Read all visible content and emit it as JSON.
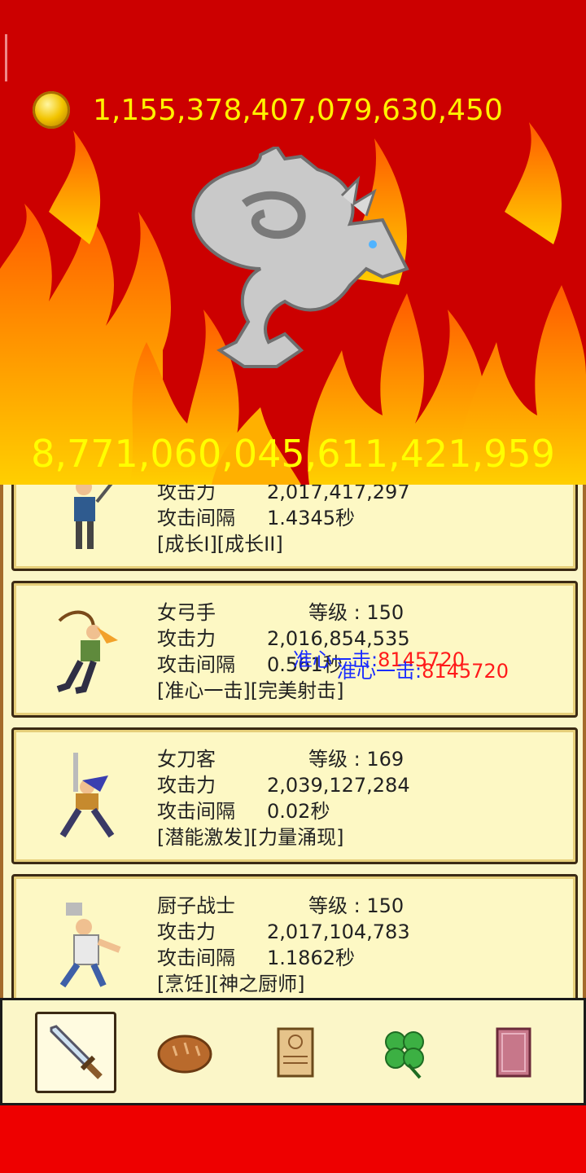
{
  "hud": {
    "gold_amount": "1,155,378,407,079,630,450",
    "boss_hp": "8,771,060,045,611,421,959"
  },
  "labels": {
    "attack": "攻击力",
    "interval": "攻击间隔",
    "level_prefix": "等级 : "
  },
  "heroes": [
    {
      "name": "",
      "level": "",
      "attack": "2,017,417,297",
      "interval": "1.4345秒",
      "skills": "[成长I][成长II]"
    },
    {
      "name": "女弓手",
      "level": "等级 : 150",
      "attack": "2,016,854,535",
      "interval": "0.561秒",
      "skills": "[准心一击][完美射击]"
    },
    {
      "name": "女刀客",
      "level": "等级 : 169",
      "attack": "2,039,127,284",
      "interval": "0.02秒",
      "skills": "[潜能激发][力量涌现]"
    },
    {
      "name": "厨子战士",
      "level": "等级 : 150",
      "attack": "2,017,104,783",
      "interval": "1.1862秒",
      "skills": "[烹饪][神之厨师]"
    }
  ],
  "floating_damage": [
    {
      "skill": "准心一击:",
      "value": "8145720"
    },
    {
      "skill": "准心一击:",
      "value": "8145720"
    }
  ],
  "nav": [
    {
      "icon": "sword-icon",
      "active": true
    },
    {
      "icon": "bread-icon",
      "active": false
    },
    {
      "icon": "scroll-icon",
      "active": false
    },
    {
      "icon": "clover-icon",
      "active": false
    },
    {
      "icon": "book-icon",
      "active": false
    }
  ],
  "colors": {
    "gold_text": "#fff200",
    "hp_text": "#ffff00",
    "panel": "#fbf6c8",
    "sky": "#cc0000"
  }
}
